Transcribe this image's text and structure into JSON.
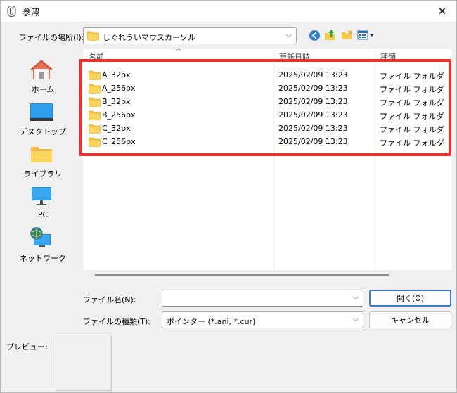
{
  "window": {
    "title": "参照",
    "close_glyph": "✕"
  },
  "location": {
    "label": "ファイルの場所(I):",
    "value": "しぐれういマウスカーソル",
    "chevron": "⌵"
  },
  "toolbar": {
    "icons": [
      "back-icon",
      "up-folder-icon",
      "new-folder-icon",
      "view-menu-icon"
    ]
  },
  "places": [
    {
      "label": "ホーム",
      "icon": "home-icon"
    },
    {
      "label": "デスクトップ",
      "icon": "desktop-icon"
    },
    {
      "label": "ライブラリ",
      "icon": "library-icon"
    },
    {
      "label": "PC",
      "icon": "pc-icon"
    },
    {
      "label": "ネットワーク",
      "icon": "network-icon"
    }
  ],
  "columns": {
    "name": "名前",
    "date": "更新日時",
    "type": "種類",
    "sort_arrow": "^"
  },
  "files": [
    {
      "name": "A_32px",
      "date": "2025/02/09 13:23",
      "type": "ファイル フォルダー"
    },
    {
      "name": "A_256px",
      "date": "2025/02/09 13:23",
      "type": "ファイル フォルダー"
    },
    {
      "name": "B_32px",
      "date": "2025/02/09 13:23",
      "type": "ファイル フォルダー"
    },
    {
      "name": "B_256px",
      "date": "2025/02/09 13:23",
      "type": "ファイル フォルダー"
    },
    {
      "name": "C_32px",
      "date": "2025/02/09 13:23",
      "type": "ファイル フォルダー"
    },
    {
      "name": "C_256px",
      "date": "2025/02/09 13:23",
      "type": "ファイル フォルダー"
    }
  ],
  "filename": {
    "label": "ファイル名(N):",
    "value": "",
    "chevron": "⌵"
  },
  "filetype": {
    "label": "ファイルの種類(T):",
    "value": "ポインター (*.ani, *.cur)",
    "chevron": "⌵"
  },
  "buttons": {
    "open": "開く(O)",
    "cancel": "キャンセル"
  },
  "preview": {
    "label": "プレビュー:"
  },
  "colors": {
    "highlight": "#f0302d",
    "folder": "#f6c94a",
    "accent": "#3b78d8"
  }
}
